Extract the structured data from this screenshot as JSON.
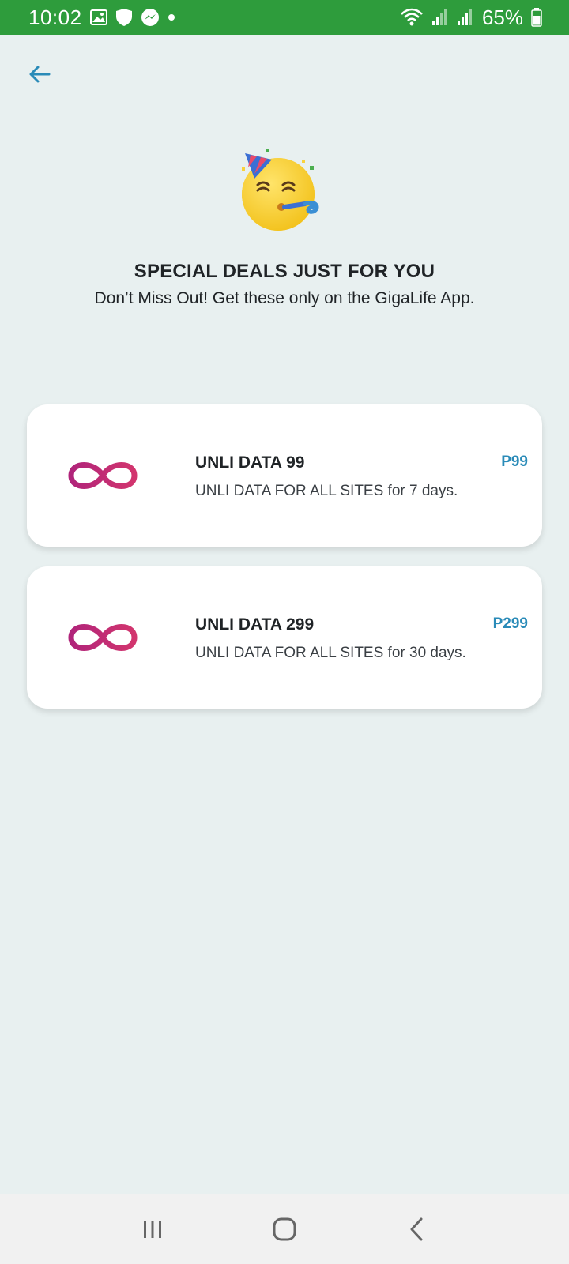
{
  "status_bar": {
    "time": "10:02",
    "battery": "65%",
    "icons": [
      "gallery-icon",
      "shield-icon",
      "messenger-icon",
      "dot-icon",
      "wifi-icon",
      "signal-icon",
      "signal-icon",
      "battery-icon"
    ],
    "background_color": "#2e9c3c"
  },
  "header": {
    "back_icon": "arrow-left-icon",
    "accent_color": "#2a8bb8"
  },
  "hero": {
    "emoji": "party-face-icon",
    "title": "SPECIAL DEALS JUST FOR YOU",
    "subtitle": "Don’t Miss Out! Get these only on the GigaLife App."
  },
  "deals": [
    {
      "icon": "infinity-icon",
      "title": "UNLI DATA 99",
      "description": "UNLI DATA FOR ALL SITES for 7 days.",
      "price": "P99"
    },
    {
      "icon": "infinity-icon",
      "title": "UNLI DATA 299",
      "description": "UNLI DATA FOR ALL SITES for 30 days.",
      "price": "P299"
    }
  ],
  "nav_bar": {
    "buttons": [
      "recent-apps-icon",
      "home-icon",
      "back-icon"
    ]
  }
}
